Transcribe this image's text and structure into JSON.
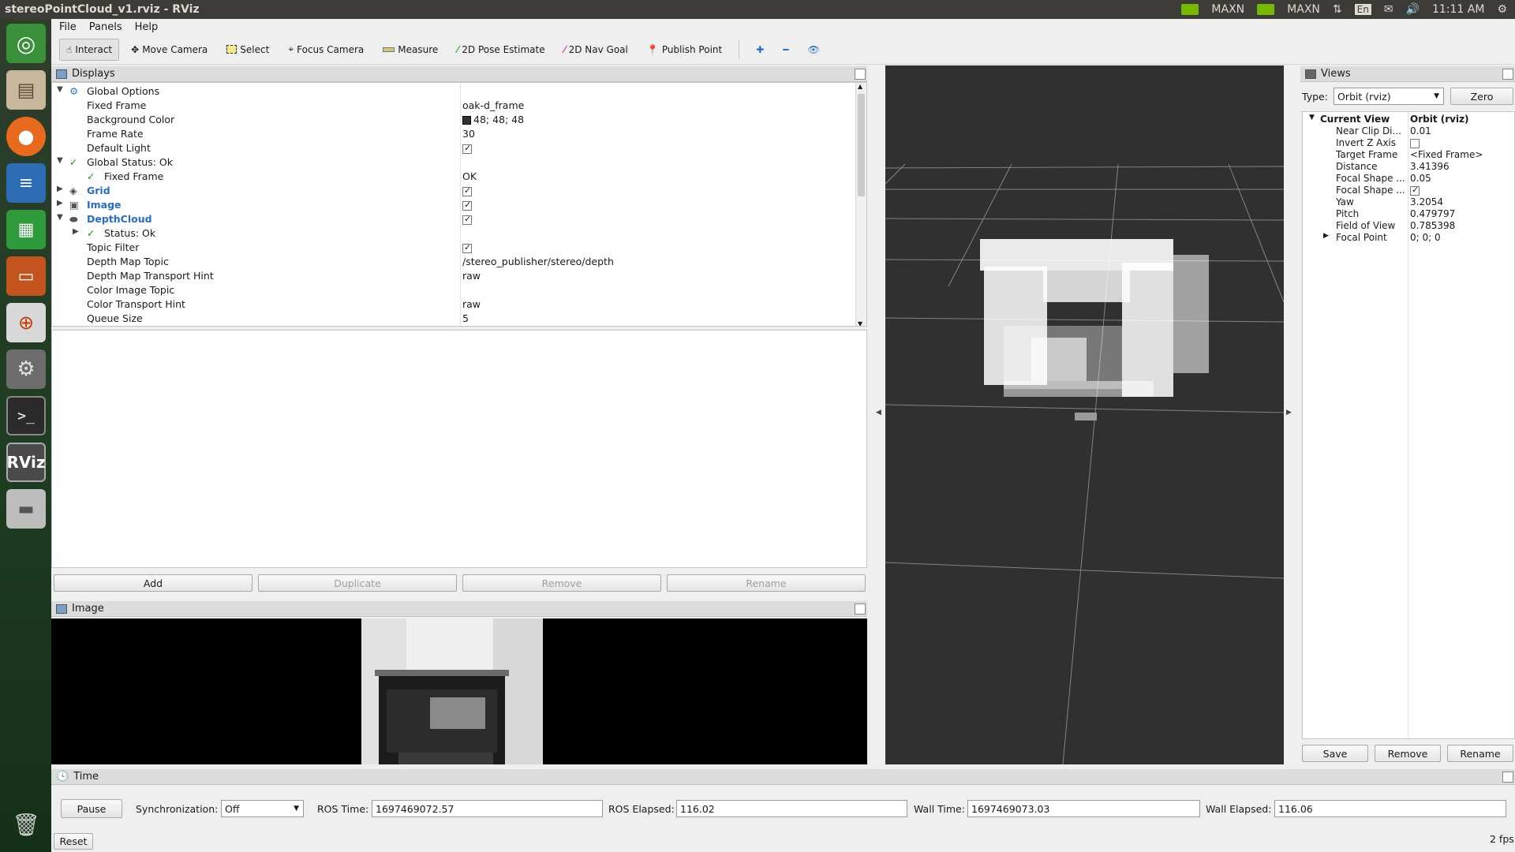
{
  "window": {
    "title": "stereoPointCloud_v1.rviz - RViz"
  },
  "systray": {
    "gpu1": "MAXN",
    "gpu2": "MAXN",
    "lang": "En",
    "clock": "11:11 AM"
  },
  "launcher": [
    "ubuntu-dash-icon",
    "files-icon",
    "firefox-icon",
    "writer-icon",
    "calc-icon",
    "impress-icon",
    "software-center-icon",
    "settings-icon",
    "terminal-icon",
    "rviz-icon",
    "drive-icon",
    "trash-icon"
  ],
  "menu": [
    "File",
    "Panels",
    "Help"
  ],
  "toolbar": {
    "interact": "Interact",
    "move_camera": "Move Camera",
    "select": "Select",
    "focus_camera": "Focus Camera",
    "measure": "Measure",
    "pose_estimate": "2D Pose Estimate",
    "nav_goal": "2D Nav Goal",
    "publish_point": "Publish Point"
  },
  "displays": {
    "title": "Displays",
    "rows": [
      {
        "k": "Global Options",
        "v": ""
      },
      {
        "k": "Fixed Frame",
        "v": "oak-d_frame"
      },
      {
        "k": "Background Color",
        "v": "48; 48; 48"
      },
      {
        "k": "Frame Rate",
        "v": "30"
      },
      {
        "k": "Default Light",
        "v": ""
      },
      {
        "k": "Global Status: Ok",
        "v": ""
      },
      {
        "k": "Fixed Frame",
        "v": "OK"
      },
      {
        "k": "Grid",
        "v": ""
      },
      {
        "k": "Image",
        "v": ""
      },
      {
        "k": "DepthCloud",
        "v": ""
      },
      {
        "k": "Status: Ok",
        "v": ""
      },
      {
        "k": "Topic Filter",
        "v": ""
      },
      {
        "k": "Depth Map Topic",
        "v": "/stereo_publisher/stereo/depth"
      },
      {
        "k": "Depth Map Transport Hint",
        "v": "raw"
      },
      {
        "k": "Color Image Topic",
        "v": ""
      },
      {
        "k": "Color Transport Hint",
        "v": "raw"
      },
      {
        "k": "Queue Size",
        "v": "5"
      }
    ],
    "buttons": {
      "add": "Add",
      "duplicate": "Duplicate",
      "remove": "Remove",
      "rename": "Rename"
    }
  },
  "image_panel": {
    "title": "Image"
  },
  "views": {
    "title": "Views",
    "type_label": "Type:",
    "type_value": "Orbit (rviz)",
    "zero": "Zero",
    "rows": [
      {
        "k": "Current View",
        "v": "Orbit (rviz)"
      },
      {
        "k": "Near Clip Di...",
        "v": "0.01"
      },
      {
        "k": "Invert Z Axis",
        "v": ""
      },
      {
        "k": "Target Frame",
        "v": "<Fixed Frame>"
      },
      {
        "k": "Distance",
        "v": "3.41396"
      },
      {
        "k": "Focal Shape ...",
        "v": "0.05"
      },
      {
        "k": "Focal Shape ...",
        "v": ""
      },
      {
        "k": "Yaw",
        "v": "3.2054"
      },
      {
        "k": "Pitch",
        "v": "0.479797"
      },
      {
        "k": "Field of View",
        "v": "0.785398"
      },
      {
        "k": "Focal Point",
        "v": "0; 0; 0"
      }
    ],
    "buttons": {
      "save": "Save",
      "remove": "Remove",
      "rename": "Rename"
    }
  },
  "time": {
    "title": "Time",
    "pause": "Pause",
    "sync_label": "Synchronization:",
    "sync_value": "Off",
    "ros_time_label": "ROS Time:",
    "ros_time": "1697469072.57",
    "ros_elapsed_label": "ROS Elapsed:",
    "ros_elapsed": "116.02",
    "wall_time_label": "Wall Time:",
    "wall_time": "1697469073.03",
    "wall_elapsed_label": "Wall Elapsed:",
    "wall_elapsed": "116.06",
    "reset": "Reset",
    "fps": "2 fps"
  },
  "colors": {
    "viewport_bg": "#303030",
    "accent_blue": "#2a6cc8",
    "status_ok": "#1d8a1d"
  }
}
